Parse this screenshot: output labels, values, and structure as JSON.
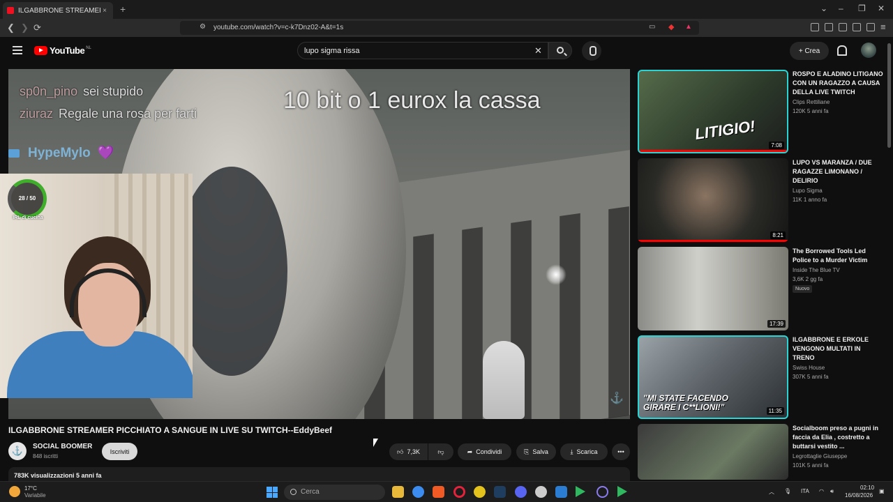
{
  "browser": {
    "tab_title": "ILGABBRONE STREAMER PICCHIATO A SANGUE IN LIVE SU TWITCH--EddyBeef",
    "tab_close": "×",
    "new_tab": "+",
    "url": "youtube.com/watch?v=c-k7Dnz02-A&t=1s",
    "window_controls": [
      "⌄",
      "–",
      "❐",
      "✕"
    ]
  },
  "youtube": {
    "logo_text": "YouTube",
    "region": "NL",
    "search_query": "lupo sigma rissa",
    "clear": "✕",
    "create_label": "+ Crea"
  },
  "video": {
    "overlay_title": "10 bit o 1 eurox la cassa",
    "chat": [
      {
        "user": "sp0n_pino",
        "text": "sei stupido"
      },
      {
        "user": "ziuraz",
        "text": "Regale una rosa per farti"
      }
    ],
    "hype_user": "HypeMylo",
    "heart": "💜",
    "goal_progress": "28 / 50",
    "goal_fraction": 0.56,
    "goal_label": "IRL di cucina",
    "title": "ILGABBRONE STREAMER PICCHIATO A SANGUE IN LIVE SU TWITCH--EddyBeef",
    "channel": "SOCIAL BOOMER",
    "subs": "848 iscritti",
    "subscribe": "Iscriviti",
    "likes": "7,3K",
    "share": "Condividi",
    "save": "Salva",
    "download": "Scarica",
    "more": "•••",
    "views": "783K visualizzazioni  5 anni fa"
  },
  "sidebar": [
    {
      "title": "ROSPO E ALADINO LITIGANO CON UN RAGAZZO A CAUSA DELLA LIVE TWITCH",
      "channel": "Clips Rettiliane",
      "meta": "120K  5 anni fa",
      "duration": "7:08",
      "thumb_text": "LITIGIO!",
      "watched": 1.0
    },
    {
      "title": "LUPO VS MARANZA / DUE RAGAZZE LIMONANO / DELIRIO",
      "channel": "Lupo Sigma",
      "meta": "11K  1 anno fa",
      "duration": "8:21",
      "thumb_text": "",
      "watched": 1.0
    },
    {
      "title": "The Borrowed Tools Led Police to a Murder Victim",
      "channel": "Inside The Blue TV",
      "meta": "3,6K  2 gg fa",
      "duration": "17:39",
      "badge": "Nuovo",
      "thumb_text": "",
      "watched": 0
    },
    {
      "title": "ILGABBRONE E ERKOLE VENGONO MULTATI IN TRENO",
      "channel": "Swiss House",
      "meta": "307K  5 anni fa",
      "duration": "11:35",
      "thumb_text": "\"MI STATE FACENDO GIRARE I C**LIONI!\"",
      "watched": 0
    },
    {
      "title": "Socialboom preso a pugni in faccia da Elia , costretto a buttarsi vestito ...",
      "channel": "Legrottaglie Giuseppe",
      "meta": "101K  5 anni fa",
      "duration": "",
      "thumb_text": "",
      "watched": 0
    }
  ],
  "taskbar": {
    "temperature": "17°C",
    "weather": "Variabile",
    "search_placeholder": "Cerca",
    "lang": "ITA",
    "time": "02:10",
    "date": "16/08/2026"
  }
}
